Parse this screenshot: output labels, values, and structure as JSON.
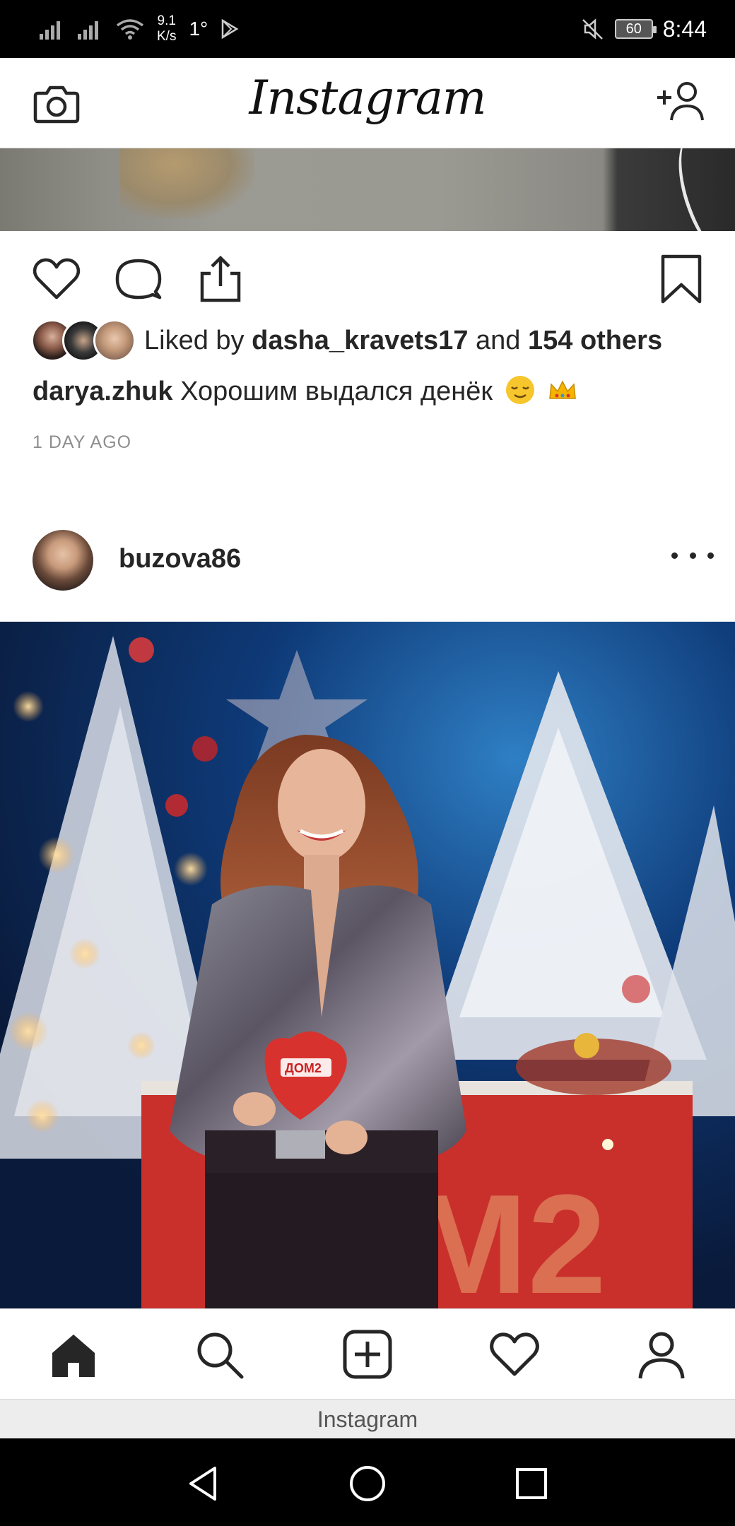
{
  "status_bar": {
    "net_speed_value": "9.1",
    "net_speed_unit": "K/s",
    "temperature": "1°",
    "battery": "60",
    "time": "8:44"
  },
  "header": {
    "app_title": "Instagram"
  },
  "current_post": {
    "likes_prefix": "Liked by",
    "liked_by_user": "dasha_kravets17",
    "likes_and": "and",
    "likes_others": "154 others",
    "caption_user": "darya.zhuk",
    "caption_text": "Хорошим выдался денёк",
    "timestamp": "1 DAY AGO"
  },
  "next_post": {
    "username": "buzova86"
  },
  "bottom_nav": {
    "items": [
      "home-icon",
      "search-icon",
      "new-post-icon",
      "activity-heart-icon",
      "profile-icon"
    ]
  },
  "app_label": "Instagram",
  "colors": {
    "text": "#262626",
    "secondary_text": "#8e8e8e",
    "divider": "#dbdbdb"
  }
}
